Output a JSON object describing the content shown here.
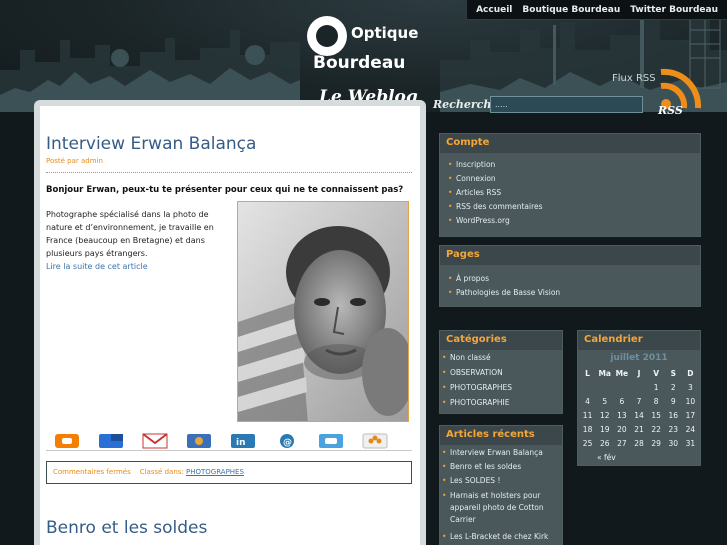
{
  "topnav": {
    "items": [
      "Accueil",
      "Boutique Bourdeau",
      "Twitter Bourdeau"
    ]
  },
  "logo": {
    "line1": "Optique",
    "line2": "Bourdeau",
    "line3": "Le Weblog"
  },
  "rss": {
    "label": "Flux RSS",
    "icon_text": "RSS"
  },
  "search": {
    "label": "Recherche",
    "value": "....."
  },
  "post1": {
    "title": "Interview Erwan Balança",
    "posted": "Posté par admin",
    "question": "Bonjour Erwan, peux-tu te présenter pour ceux qui ne te connaissent pas?",
    "body": "Photographe spécialisé dans la photo de nature et d’environnement, je travaille en France (beaucoup en Bretagne) et dans plusieurs pays étrangers.",
    "read_more": "Lire la suite de cet article",
    "comments": "Commentaires fermés",
    "category_label": "Classé dans:",
    "category": "PHOTOGRAPHES"
  },
  "share_icons": [
    "blogger-icon",
    "delicious-icon",
    "gmail-icon",
    "digg-icon",
    "linkedin-icon",
    "email-icon",
    "twitter-icon",
    "more-share-icon"
  ],
  "post2": {
    "title": "Benro et les soldes"
  },
  "sidebar": {
    "compte": {
      "title": "Compte",
      "items": [
        "Inscription",
        "Connexion",
        "Articles RSS",
        "RSS des commentaires",
        "WordPress.org"
      ]
    },
    "pages": {
      "title": "Pages",
      "items": [
        "À propos",
        "Pathologies de Basse Vision"
      ]
    },
    "categories": {
      "title": "Catégories",
      "items": [
        "Non classé",
        "OBSERVATION",
        "PHOTOGRAPHES",
        "PHOTOGRAPHIE"
      ]
    },
    "recent": {
      "title": "Articles récents",
      "items": [
        "Interview Erwan Balança",
        "Benro et les soldes",
        "Les SOLDES !",
        "Harnais et holsters pour appareil photo de Cotton Carrier",
        "Les L-Bracket de chez Kirk Enterprises"
      ]
    },
    "calendar": {
      "title": "Calendrier",
      "caption": "juillet 2011",
      "days": [
        "L",
        "Ma",
        "Me",
        "J",
        "V",
        "S",
        "D"
      ],
      "weeks": [
        [
          "",
          "",
          "",
          "",
          "1",
          "2",
          "3"
        ],
        [
          "4",
          "5",
          "6",
          "7",
          "8",
          "9",
          "10"
        ],
        [
          "11",
          "12",
          "13",
          "14",
          "15",
          "16",
          "17"
        ],
        [
          "18",
          "19",
          "20",
          "21",
          "22",
          "23",
          "24"
        ],
        [
          "25",
          "26",
          "27",
          "28",
          "29",
          "30",
          "31"
        ]
      ],
      "prev": "« fév"
    }
  },
  "colors": {
    "accent_orange": "#f4a637",
    "title_blue": "#355c86",
    "link_blue": "#3a74ad",
    "sidebar_bg": "#3b474a"
  }
}
